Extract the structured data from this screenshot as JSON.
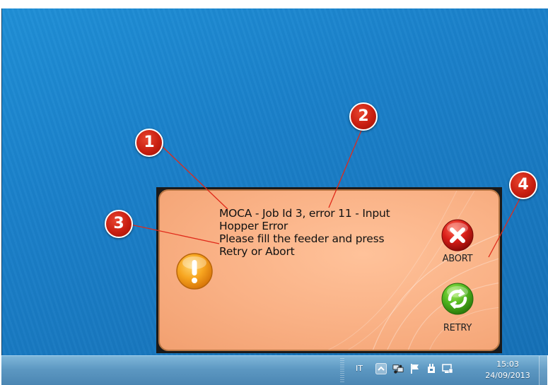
{
  "dialog": {
    "message_lines": [
      "MOCA - Job Id 3, error 11 -  Input",
      "Hopper Error",
      "Please fill the feeder and press",
      "Retry or Abort"
    ],
    "abort_label": "ABORT",
    "retry_label": "RETRY",
    "icons": {
      "warning": "warning-icon",
      "abort": "x-icon",
      "retry": "refresh-icon"
    },
    "colors": {
      "background": "#f9b084",
      "abort": "#d81e18",
      "retry": "#4fb51e",
      "warning": "#f59a1a"
    }
  },
  "callouts": [
    "1",
    "2",
    "3",
    "4"
  ],
  "taskbar": {
    "language": "IT",
    "time": "15:03",
    "date": "24/09/2013",
    "tray_icons": [
      "show-hidden-icons-icon",
      "network-icon",
      "action-center-flag-icon",
      "power-icon",
      "display-icon"
    ]
  }
}
